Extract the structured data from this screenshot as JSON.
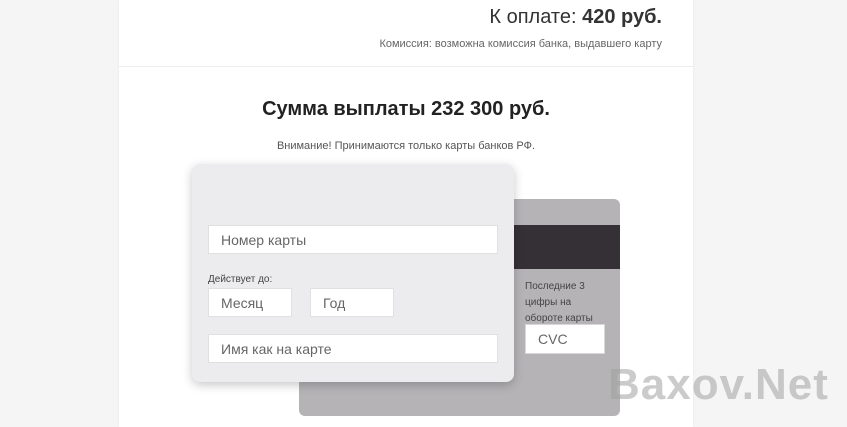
{
  "payment": {
    "label": "К оплате: ",
    "amount": "420 руб.",
    "commission": "Комиссия: возможна комиссия банка, выдавшего карту"
  },
  "payout": {
    "title": "Сумма выплаты 232 300 руб.",
    "warning": "Внимание! Принимаются только карты банков РФ."
  },
  "card_front": {
    "card_number_placeholder": "Номер карты",
    "valid_label": "Действует до:",
    "month_placeholder": "Месяц",
    "year_placeholder": "Год",
    "holder_placeholder": "Имя как на карте"
  },
  "card_back": {
    "cvc_hint": "Последние 3 цифры на обороте карты",
    "cvc_placeholder": "CVC"
  },
  "watermark": "Baxov.Net",
  "colors": {
    "back_card": "#b5b3b6",
    "mag_strip": "#353036",
    "front_card": "#ececee"
  }
}
